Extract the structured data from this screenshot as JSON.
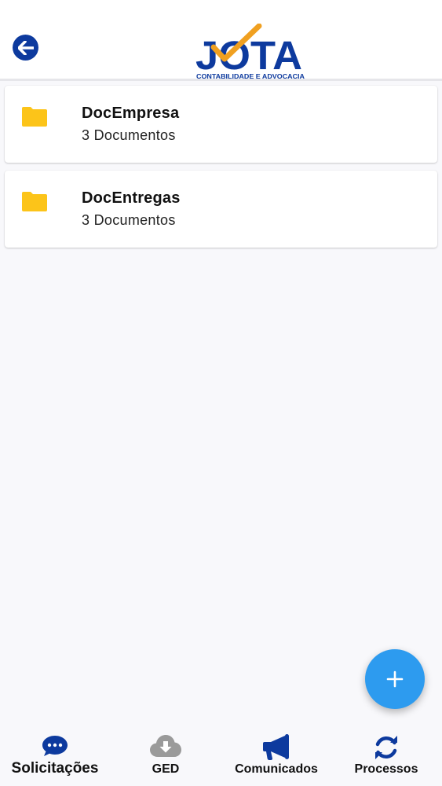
{
  "header": {
    "back_icon": "arrow-left-circle-icon",
    "logo": {
      "word": "JOTA",
      "tagline": "CONTABILIDADE E ADVOCACIA"
    }
  },
  "folders": [
    {
      "name": "DocEmpresa",
      "count": "3 Documentos",
      "icon": "folder-icon"
    },
    {
      "name": "DocEntregas",
      "count": "3 Documentos",
      "icon": "folder-icon"
    }
  ],
  "fab": {
    "icon": "plus-icon"
  },
  "bottom_nav": {
    "items": [
      {
        "label": "Solicitações",
        "icon": "chat-bubble-icon",
        "active": true
      },
      {
        "label": "GED",
        "icon": "cloud-download-icon",
        "active": false
      },
      {
        "label": "Comunicados",
        "icon": "megaphone-icon",
        "active": false
      },
      {
        "label": "Processos",
        "icon": "sync-icon",
        "active": false
      }
    ]
  },
  "colors": {
    "brand_blue": "#0d3a9e",
    "accent_orange": "#f0a020",
    "folder_yellow": "#fcc419",
    "fab_blue": "#2d9bef",
    "inactive_gray": "#9a9a9a"
  }
}
